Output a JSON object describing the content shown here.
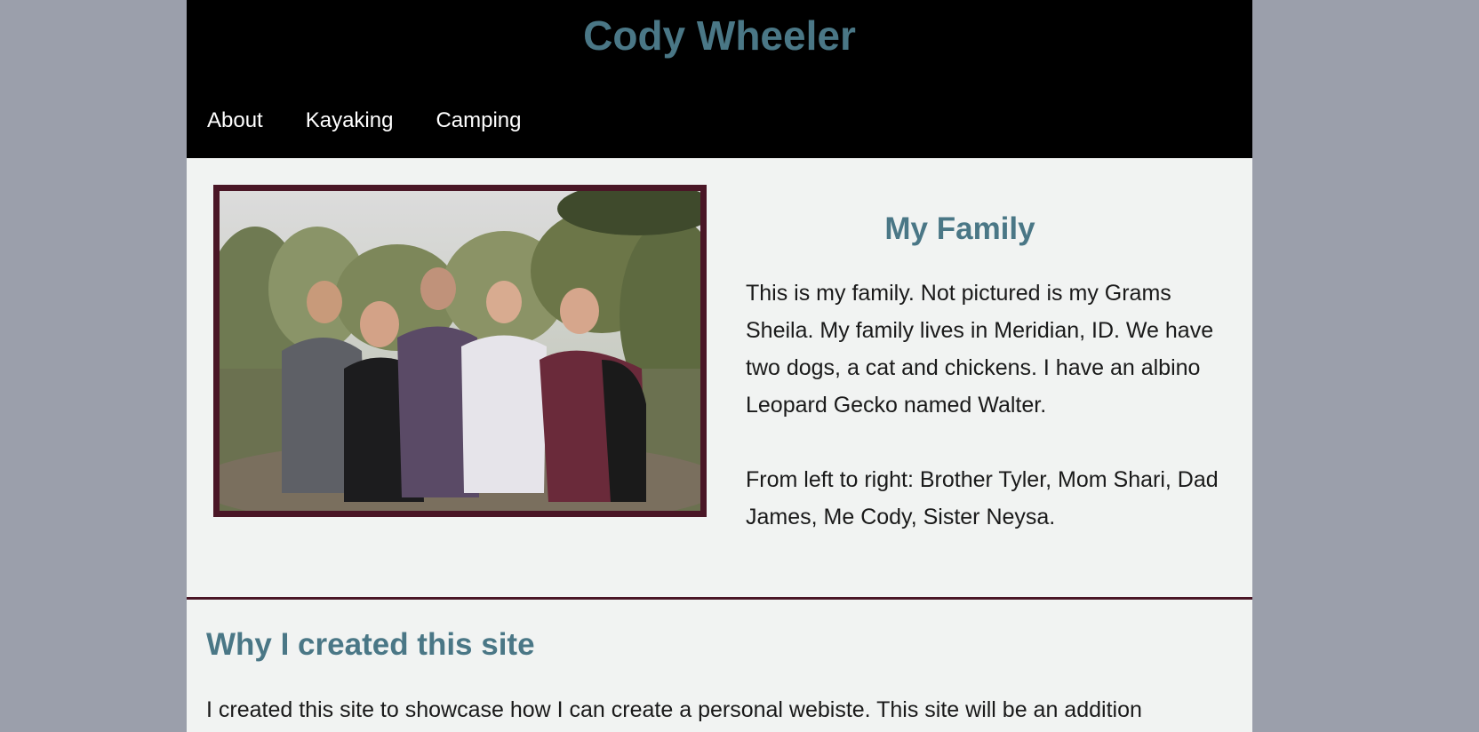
{
  "header": {
    "site_title": "Cody Wheeler",
    "nav": [
      {
        "label": "About"
      },
      {
        "label": "Kayaking"
      },
      {
        "label": "Camping"
      }
    ]
  },
  "family": {
    "photo_alt": "Family photo",
    "heading": "My Family",
    "paragraphs": [
      "This is my family. Not pictured is my Grams Sheila. My family lives in Meridian, ID. We have two dogs, a cat and chickens. I have an albino Leopard Gecko named Walter.",
      "From left to right: Brother Tyler, Mom Shari, Dad James, Me Cody, Sister Neysa."
    ]
  },
  "why": {
    "heading": "Why I created this site",
    "text": "I created this site to showcase how I can create a personal webiste. This site will be an addition"
  },
  "colors": {
    "page_background": "#9b9fab",
    "content_background": "#f1f3f2",
    "header_background": "#000000",
    "heading_color": "#4a7786",
    "accent_maroon": "#4a1626"
  }
}
